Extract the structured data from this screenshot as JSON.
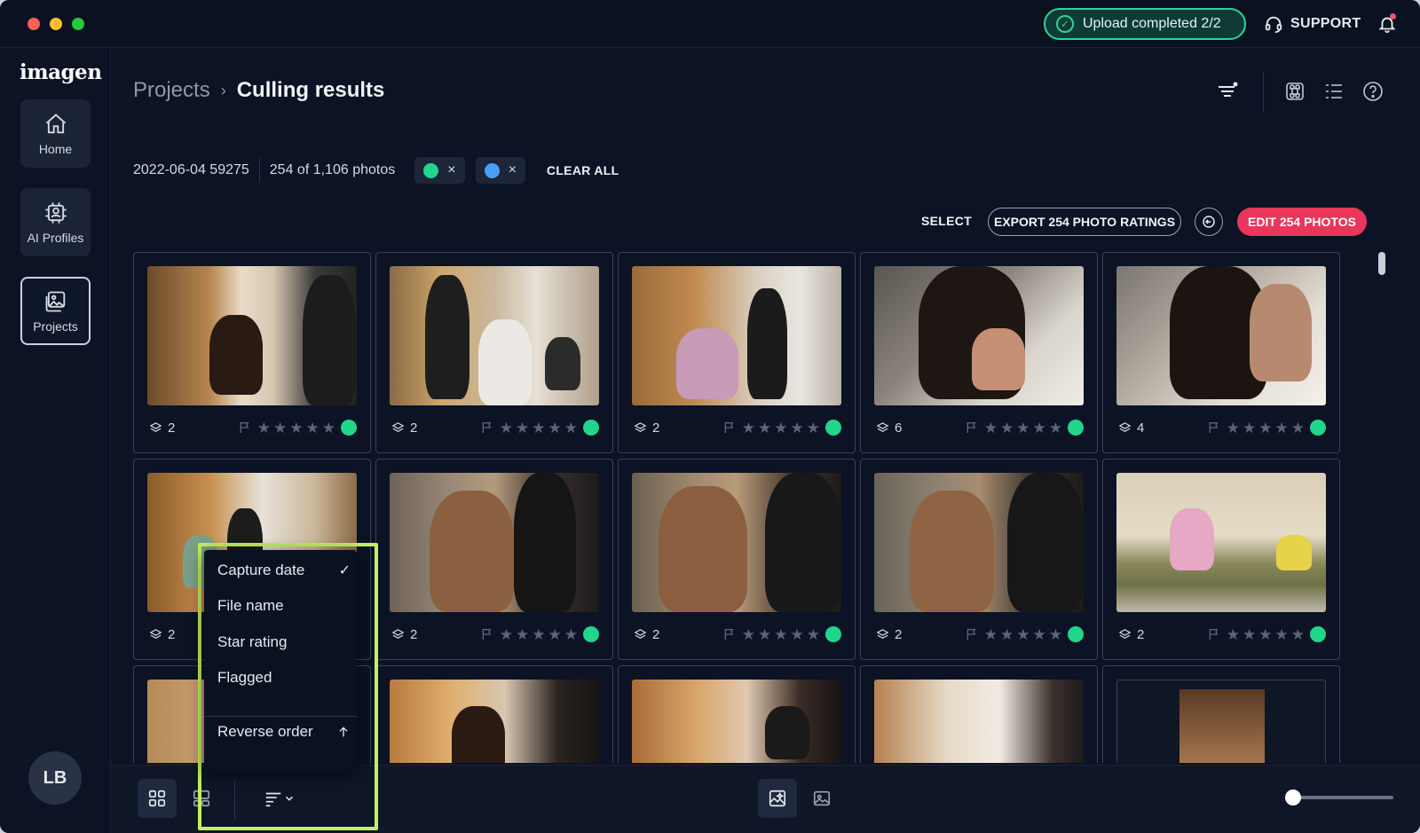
{
  "titlebar": {
    "upload_status": "Upload completed 2/2",
    "support_label": "SUPPORT"
  },
  "sidebar": {
    "logo": "imagen",
    "items": [
      {
        "label": "Home",
        "icon": "home-icon"
      },
      {
        "label": "AI Profiles",
        "icon": "ai-profiles-icon"
      },
      {
        "label": "Projects",
        "icon": "projects-icon",
        "active": true
      }
    ],
    "avatar_initials": "LB"
  },
  "header": {
    "breadcrumb_root": "Projects",
    "breadcrumb_sep": "›",
    "breadcrumb_current": "Culling results"
  },
  "filters": {
    "project_name": "2022-06-04 59275",
    "photo_count": "254 of 1,106 photos",
    "chips": [
      {
        "color": "#21d58b",
        "remove": "×"
      },
      {
        "color": "#4a9ff5",
        "remove": "×"
      }
    ],
    "clear_all": "CLEAR ALL"
  },
  "actions": {
    "select": "SELECT",
    "export": "EXPORT 254 PHOTO RATINGS",
    "edit": "EDIT 254 PHOTOS"
  },
  "photos": [
    {
      "count": "2"
    },
    {
      "count": "2"
    },
    {
      "count": "2"
    },
    {
      "count": "6"
    },
    {
      "count": "4"
    },
    {
      "count": "2"
    },
    {
      "count": "2"
    },
    {
      "count": "2"
    },
    {
      "count": "2"
    },
    {
      "count": "2"
    },
    {
      "count": ""
    },
    {
      "count": ""
    },
    {
      "count": ""
    },
    {
      "count": ""
    },
    {
      "count": ""
    }
  ],
  "sort_menu": {
    "options": [
      "Capture date",
      "File name",
      "Star rating",
      "Flagged"
    ],
    "selected": "Capture date",
    "reverse_label": "Reverse order"
  },
  "colors": {
    "accent": "#e9365a",
    "status_green": "#21d58b",
    "highlight": "#c5ef62"
  }
}
